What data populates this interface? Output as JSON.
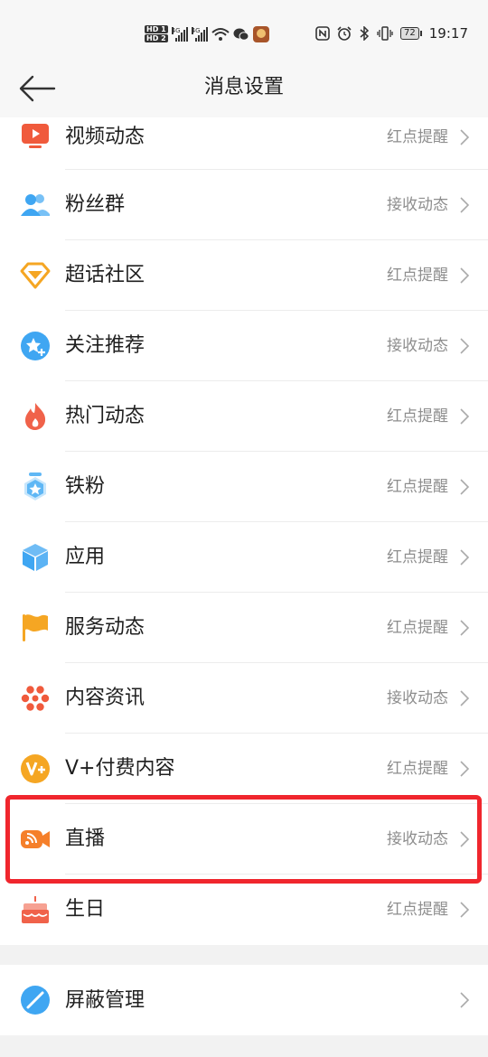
{
  "status_bar": {
    "hd1": "HD 1",
    "hd2": "HD 2",
    "net1": "4G",
    "net2": "4G",
    "battery": "72",
    "time": "19:17"
  },
  "header": {
    "title": "消息设置"
  },
  "settings": [
    {
      "label": "视频动态",
      "status": "红点提醒",
      "icon": "video-icon",
      "color": "#f05a3c"
    },
    {
      "label": "粉丝群",
      "status": "接收动态",
      "icon": "fans-group-icon",
      "color": "#3fa6f2"
    },
    {
      "label": "超话社区",
      "status": "红点提醒",
      "icon": "diamond-icon",
      "color": "#f5a623"
    },
    {
      "label": "关注推荐",
      "status": "接收动态",
      "icon": "star-plus-icon",
      "color": "#3fa6f2"
    },
    {
      "label": "热门动态",
      "status": "红点提醒",
      "icon": "flame-icon",
      "color": "#f0624a"
    },
    {
      "label": "铁粉",
      "status": "红点提醒",
      "icon": "medal-icon",
      "color": "#5fb7f5"
    },
    {
      "label": "应用",
      "status": "红点提醒",
      "icon": "cube-icon",
      "color": "#3fa6f2"
    },
    {
      "label": "服务动态",
      "status": "红点提醒",
      "icon": "flag-icon",
      "color": "#f5a623"
    },
    {
      "label": "内容资讯",
      "status": "接收动态",
      "icon": "flower-icon",
      "color": "#f05a3c"
    },
    {
      "label": "V+付费内容",
      "status": "红点提醒",
      "icon": "vplus-icon",
      "color": "#f5a623"
    },
    {
      "label": "直播",
      "status": "接收动态",
      "icon": "live-camera-icon",
      "color": "#f57f2a"
    },
    {
      "label": "生日",
      "status": "红点提醒",
      "icon": "cake-icon",
      "color": "#f0624a"
    }
  ],
  "block_section": {
    "label": "屏蔽管理",
    "icon": "block-icon",
    "color": "#3fa6f2"
  }
}
